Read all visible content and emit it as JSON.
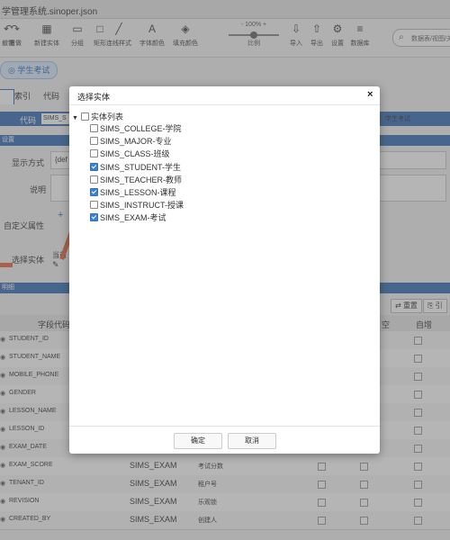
{
  "window": {
    "title": "学管理系统.sinoper.json"
  },
  "toolbar": {
    "items": [
      {
        "icon": "undo-icon",
        "glyph": "↶",
        "label": "撤销"
      },
      {
        "icon": "redo-icon",
        "glyph": "↷",
        "label": "重做"
      },
      {
        "icon": "add-entity-icon",
        "glyph": "▦",
        "label": "新建实体"
      },
      {
        "icon": "group-icon",
        "glyph": "▭",
        "label": "分组"
      },
      {
        "icon": "rect-icon",
        "glyph": "□",
        "label": "矩形"
      },
      {
        "icon": "edge-style-icon",
        "glyph": "╱",
        "label": "连线样式"
      },
      {
        "icon": "font-color-icon",
        "glyph": "A",
        "label": "字体颜色"
      },
      {
        "icon": "fill-color-icon",
        "glyph": "◈",
        "label": "填充颜色"
      }
    ],
    "zoom": {
      "value_label": "- 100% +",
      "caption": "比例",
      "level_percent": 100
    },
    "right_items": [
      {
        "icon": "import-icon",
        "glyph": "⇩",
        "label": "导入"
      },
      {
        "icon": "export-icon",
        "glyph": "⇧",
        "label": "导出"
      },
      {
        "icon": "settings-icon",
        "glyph": "⚙",
        "label": "设置"
      },
      {
        "icon": "database-icon",
        "glyph": "≡",
        "label": "数据库"
      }
    ],
    "search_placeholder": "数据表/视图/关"
  },
  "entity_tab": {
    "label": "学生考试"
  },
  "subtabs": {
    "index": "索引",
    "code": "代码"
  },
  "form": {
    "code_label": "代码",
    "code_value": "SIMS_S",
    "code_right": "学生考试",
    "section_settings": "设置",
    "display_label": "显示方式",
    "display_value": "{def",
    "desc_label": "说明",
    "custom_label": "自定义属性",
    "select_entity_label": "选择实体",
    "select_entity_value": "当前"
  },
  "grid": {
    "section_title": "明细",
    "tools": {
      "btn_reset": "重置",
      "btn_quote": "引"
    },
    "headers": {
      "field_code": "字段代码",
      "empty": "空",
      "auto_inc": "自增"
    },
    "rows": [
      {
        "name": "STUDENT_ID",
        "entity": "",
        "comment": ""
      },
      {
        "name": "STUDENT_NAME",
        "entity": "",
        "comment": ""
      },
      {
        "name": "MOBILE_PHONE",
        "entity": "",
        "comment": ""
      },
      {
        "name": "GENDER",
        "entity": "",
        "comment": ""
      },
      {
        "name": "LESSON_NAME",
        "entity": "",
        "comment": ""
      },
      {
        "name": "LESSON_ID",
        "entity": "",
        "comment": ""
      },
      {
        "name": "EXAM_DATE",
        "entity": "",
        "comment": ""
      },
      {
        "name": "EXAM_SCORE",
        "entity": "SIMS_EXAM",
        "comment": "考试分数"
      },
      {
        "name": "TENANT_ID",
        "entity": "SIMS_EXAM",
        "comment": "租户号"
      },
      {
        "name": "REVISION",
        "entity": "SIMS_EXAM",
        "comment": "乐观锁"
      },
      {
        "name": "CREATED_BY",
        "entity": "SIMS_EXAM",
        "comment": "创建人"
      }
    ]
  },
  "modal": {
    "title": "选择实体",
    "close": "×",
    "root_label": "实体列表",
    "items": [
      {
        "label": "SIMS_COLLEGE-学院",
        "checked": false
      },
      {
        "label": "SIMS_MAJOR-专业",
        "checked": false
      },
      {
        "label": "SIMS_CLASS-班级",
        "checked": false
      },
      {
        "label": "SIMS_STUDENT-学生",
        "checked": true
      },
      {
        "label": "SIMS_TEACHER-教师",
        "checked": false
      },
      {
        "label": "SIMS_LESSON-课程",
        "checked": true
      },
      {
        "label": "SIMS_INSTRUCT-授课",
        "checked": false
      },
      {
        "label": "SIMS_EXAM-考试",
        "checked": true
      }
    ],
    "ok_label": "确定",
    "cancel_label": "取消"
  },
  "colors": {
    "accent": "#3a6fb6",
    "arrow": "#e8663c",
    "checkbox_on": "#3b82d9"
  }
}
